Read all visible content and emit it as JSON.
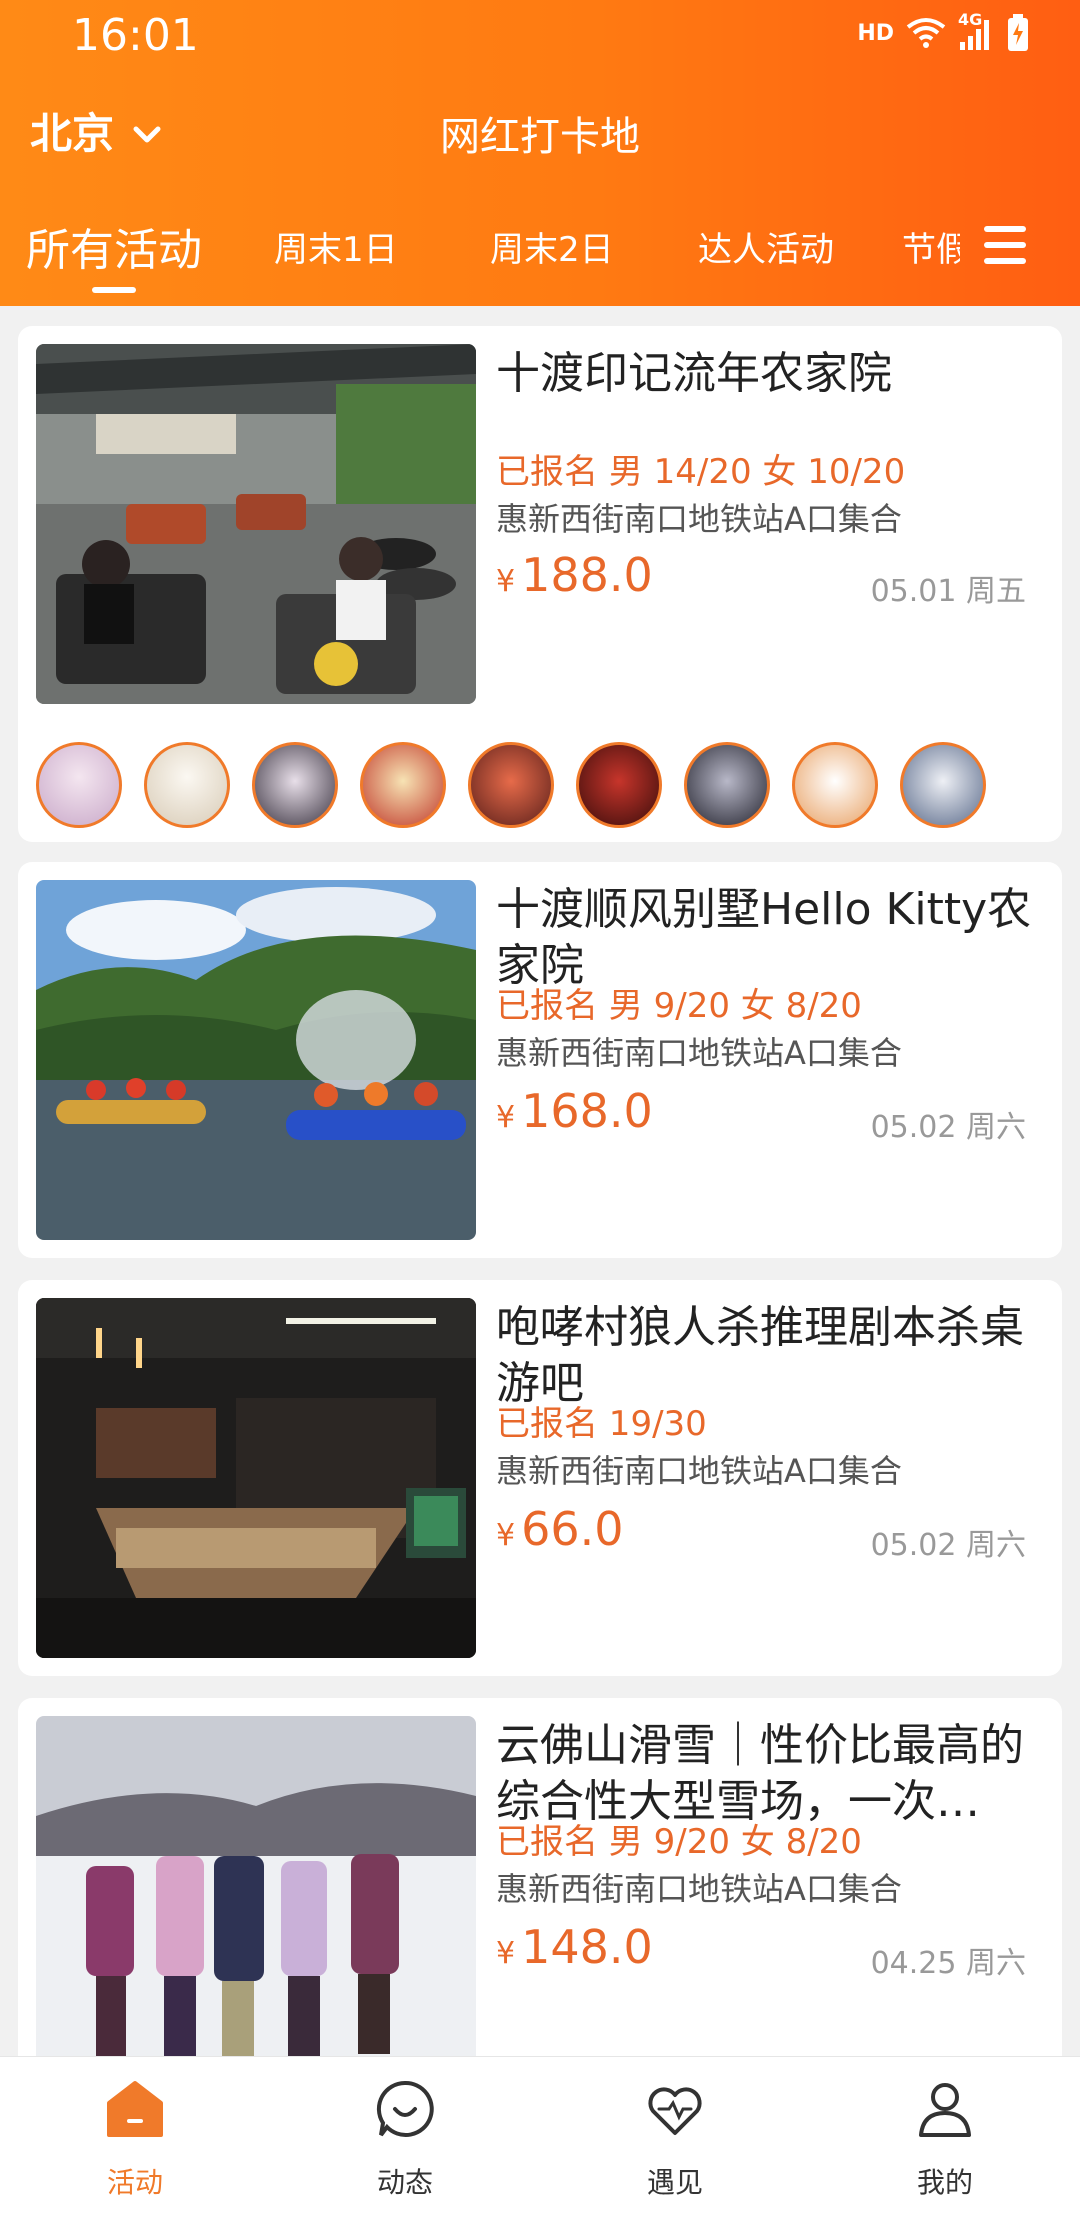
{
  "status_bar": {
    "time": "16:01",
    "network_label": "HD",
    "network_type": "4G"
  },
  "header": {
    "city": "北京",
    "title": "网红打卡地",
    "tabs": [
      "所有活动",
      "周末1日",
      "周末2日",
      "达人活动",
      "节假"
    ]
  },
  "activities": [
    {
      "title": "十渡印记流年农家院",
      "signup": "已报名 男 14/20  女 10/20",
      "location": "惠新西街南口地铁站A口集合",
      "currency": "¥",
      "price": "188.0",
      "date": "05.01 周五"
    },
    {
      "title": "十渡顺风别墅Hello Kitty农家院",
      "signup": "已报名 男 9/20  女 8/20",
      "location": "惠新西街南口地铁站A口集合",
      "currency": "¥",
      "price": "168.0",
      "date": "05.02 周六"
    },
    {
      "title": "咆哮村狼人杀推理剧本杀桌游吧",
      "signup": "已报名 19/30",
      "location": "惠新西街南口地铁站A口集合",
      "currency": "¥",
      "price": "66.0",
      "date": "05.02 周六"
    },
    {
      "title": "云佛山滑雪｜性价比最高的综合性大型雪场，一次…",
      "signup": "已报名 男 9/20  女 8/20",
      "location": "惠新西街南口地铁站A口集合",
      "currency": "¥",
      "price": "148.0",
      "date": "04.25 周六"
    }
  ],
  "bottom_nav": [
    "活动",
    "动态",
    "遇见",
    "我的"
  ],
  "colors": {
    "accent": "#f07a2a",
    "header_start": "#ff8a16",
    "header_end": "#ff5e12"
  }
}
